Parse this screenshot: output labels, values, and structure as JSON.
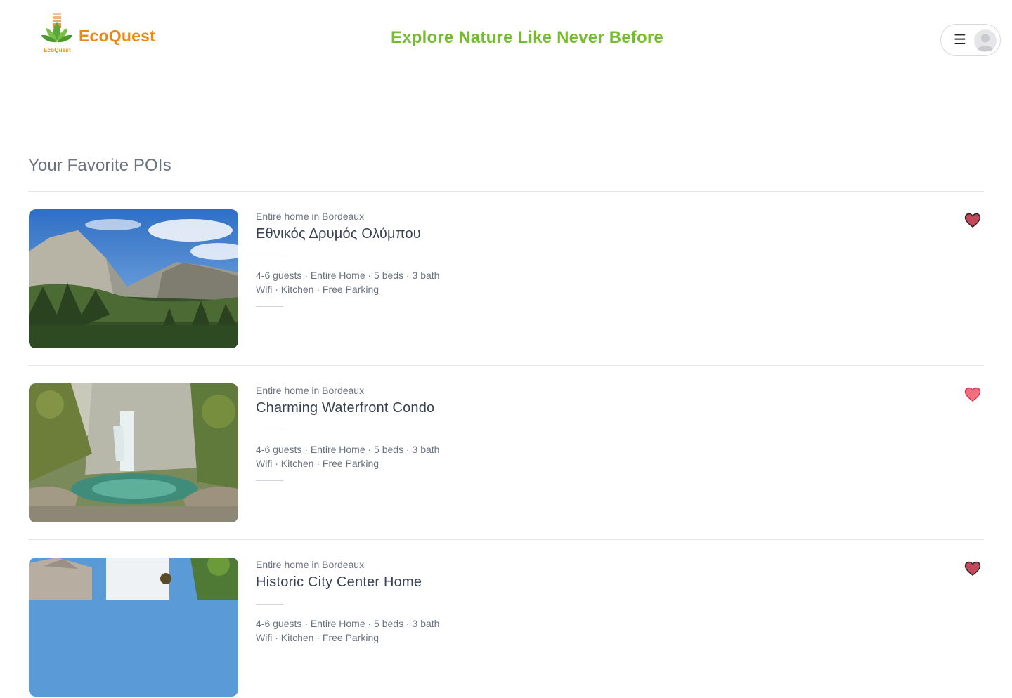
{
  "brand": {
    "name": "EcoQuest",
    "logo_sub": "EcoQuest"
  },
  "tagline": "Explore Nature Like Never Before",
  "menu": {
    "icon": "hamburger-icon",
    "avatar_icon": "user-avatar-icon"
  },
  "section_title": "Your Favorite POIs",
  "favorites": [
    {
      "kind": "Entire home in Bordeaux",
      "title": "Εθνικός Δρυμός Ολύμπου",
      "specs": "4-6 guests · Entire Home · 5 beds · 3 bath",
      "amenities": "Wifi · Kitchen · Free Parking",
      "image": "mountain-valley-forest-photo",
      "heart_color": "#c2485a"
    },
    {
      "kind": "Entire home in Bordeaux",
      "title": "Charming Waterfront Condo",
      "specs": "4-6 guests · Entire Home · 5 beds · 3 bath",
      "amenities": "Wifi · Kitchen · Free Parking",
      "image": "waterfall-pool-photo",
      "heart_color": "#f07080"
    },
    {
      "kind": "Entire home in Bordeaux",
      "title": "Historic City Center Home",
      "specs": "4-6 guests · Entire Home · 5 beds · 3 bath",
      "amenities": "Wifi · Kitchen · Free Parking",
      "image": "stone-houses-photo",
      "heart_color": "#c2485a"
    }
  ],
  "colors": {
    "brand_orange": "#e8891c",
    "tagline_green": "#76bd2c"
  }
}
